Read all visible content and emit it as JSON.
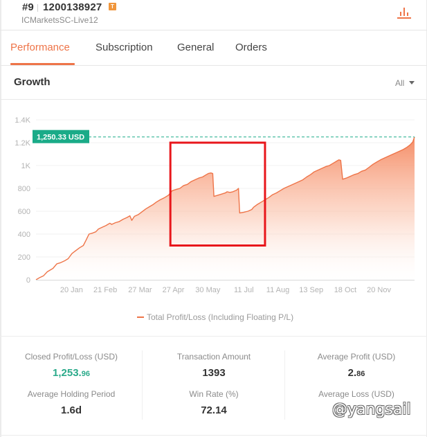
{
  "header": {
    "rank": "#9",
    "account_number": "1200138927",
    "badge": "T",
    "server": "ICMarketsSC-Live12",
    "chart_icon": "bar-chart-icon"
  },
  "tabs": [
    {
      "label": "Performance",
      "active": true
    },
    {
      "label": "Subscription",
      "active": false
    },
    {
      "label": "General",
      "active": false
    },
    {
      "label": "Orders",
      "active": false
    }
  ],
  "growth": {
    "title": "Growth",
    "range": "All"
  },
  "colors": {
    "accent": "#ee7448",
    "positive": "#2aaa8a",
    "highlight_box": "#e8161b"
  },
  "chart_data": {
    "type": "area",
    "title": "Growth",
    "xlabel": "",
    "ylabel": "",
    "y_ticks": [
      "0",
      "200",
      "400",
      "600",
      "800",
      "1K",
      "1.2K",
      "1.4K"
    ],
    "y_tick_values": [
      0,
      200,
      400,
      600,
      800,
      1000,
      1200,
      1400
    ],
    "ylim": [
      0,
      1400
    ],
    "x_ticks": [
      "20 Jan",
      "21 Feb",
      "27 Mar",
      "27 Apr",
      "30 May",
      "11 Jul",
      "11 Aug",
      "13 Sep",
      "18 Oct",
      "20 Nov"
    ],
    "x_tick_positions": [
      0.094,
      0.183,
      0.275,
      0.363,
      0.454,
      0.549,
      0.639,
      0.727,
      0.817,
      0.906
    ],
    "grid": true,
    "legend": "bottom-center",
    "series": [
      {
        "name": "Total Profit/Loss (Including Floating P/L)",
        "points": [
          [
            0.0,
            0
          ],
          [
            0.01,
            20
          ],
          [
            0.02,
            35
          ],
          [
            0.03,
            70
          ],
          [
            0.045,
            100
          ],
          [
            0.055,
            140
          ],
          [
            0.065,
            150
          ],
          [
            0.075,
            165
          ],
          [
            0.085,
            185
          ],
          [
            0.095,
            230
          ],
          [
            0.105,
            255
          ],
          [
            0.115,
            280
          ],
          [
            0.125,
            300
          ],
          [
            0.132,
            345
          ],
          [
            0.14,
            400
          ],
          [
            0.15,
            410
          ],
          [
            0.158,
            420
          ],
          [
            0.165,
            445
          ],
          [
            0.175,
            460
          ],
          [
            0.185,
            475
          ],
          [
            0.195,
            495
          ],
          [
            0.2,
            485
          ],
          [
            0.21,
            500
          ],
          [
            0.22,
            510
          ],
          [
            0.23,
            530
          ],
          [
            0.24,
            545
          ],
          [
            0.248,
            560
          ],
          [
            0.253,
            520
          ],
          [
            0.26,
            555
          ],
          [
            0.27,
            570
          ],
          [
            0.28,
            595
          ],
          [
            0.29,
            620
          ],
          [
            0.3,
            640
          ],
          [
            0.31,
            660
          ],
          [
            0.318,
            680
          ],
          [
            0.328,
            700
          ],
          [
            0.34,
            720
          ],
          [
            0.35,
            740
          ],
          [
            0.36,
            780
          ],
          [
            0.37,
            790
          ],
          [
            0.38,
            800
          ],
          [
            0.39,
            825
          ],
          [
            0.4,
            835
          ],
          [
            0.41,
            860
          ],
          [
            0.42,
            875
          ],
          [
            0.43,
            890
          ],
          [
            0.44,
            900
          ],
          [
            0.45,
            920
          ],
          [
            0.455,
            930
          ],
          [
            0.462,
            935
          ],
          [
            0.467,
            930
          ],
          [
            0.47,
            730
          ],
          [
            0.48,
            740
          ],
          [
            0.49,
            750
          ],
          [
            0.5,
            760
          ],
          [
            0.505,
            770
          ],
          [
            0.512,
            765
          ],
          [
            0.52,
            770
          ],
          [
            0.53,
            785
          ],
          [
            0.535,
            800
          ],
          [
            0.538,
            585
          ],
          [
            0.548,
            590
          ],
          [
            0.56,
            600
          ],
          [
            0.57,
            615
          ],
          [
            0.575,
            635
          ],
          [
            0.585,
            660
          ],
          [
            0.595,
            680
          ],
          [
            0.605,
            700
          ],
          [
            0.615,
            720
          ],
          [
            0.625,
            745
          ],
          [
            0.635,
            760
          ],
          [
            0.645,
            780
          ],
          [
            0.655,
            800
          ],
          [
            0.665,
            815
          ],
          [
            0.675,
            830
          ],
          [
            0.685,
            845
          ],
          [
            0.695,
            860
          ],
          [
            0.705,
            875
          ],
          [
            0.715,
            900
          ],
          [
            0.725,
            920
          ],
          [
            0.735,
            945
          ],
          [
            0.745,
            960
          ],
          [
            0.755,
            975
          ],
          [
            0.765,
            990
          ],
          [
            0.775,
            1000
          ],
          [
            0.785,
            1020
          ],
          [
            0.795,
            1040
          ],
          [
            0.8,
            1050
          ],
          [
            0.805,
            1045
          ],
          [
            0.81,
            880
          ],
          [
            0.82,
            890
          ],
          [
            0.83,
            905
          ],
          [
            0.84,
            920
          ],
          [
            0.85,
            930
          ],
          [
            0.86,
            950
          ],
          [
            0.87,
            960
          ],
          [
            0.88,
            985
          ],
          [
            0.89,
            1010
          ],
          [
            0.9,
            1030
          ],
          [
            0.91,
            1050
          ],
          [
            0.92,
            1065
          ],
          [
            0.93,
            1080
          ],
          [
            0.94,
            1095
          ],
          [
            0.95,
            1110
          ],
          [
            0.96,
            1125
          ],
          [
            0.97,
            1140
          ],
          [
            0.98,
            1160
          ],
          [
            0.988,
            1180
          ],
          [
            0.995,
            1205
          ],
          [
            1.0,
            1250
          ]
        ]
      }
    ],
    "annotations": [
      {
        "type": "current-value-label",
        "text": "1,250.33 USD",
        "value": 1250.33,
        "color": "#1aab88"
      },
      {
        "type": "highlight-box",
        "x_range": [
          0.355,
          0.605
        ],
        "y_range": [
          300,
          1200
        ],
        "color": "#e8161b"
      }
    ]
  },
  "legend": {
    "label": "Total Profit/Loss (Including Floating P/L)"
  },
  "stats": [
    {
      "label": "Closed Profit/Loss (USD)",
      "value_main": "1,253.",
      "value_small": "96",
      "color": "green"
    },
    {
      "label": "Transaction Amount",
      "value_main": "1393",
      "value_small": ""
    },
    {
      "label": "Average Profit (USD)",
      "value_main": "2.",
      "value_small": "86"
    },
    {
      "label": "Average Holding Period",
      "value_main": "1.6d",
      "value_small": ""
    },
    {
      "label": "Win Rate (%)",
      "value_main": "72.14",
      "value_small": ""
    },
    {
      "label": "Average Loss (USD)",
      "value_main": "",
      "value_small": ""
    }
  ],
  "watermark": "@yangsail"
}
